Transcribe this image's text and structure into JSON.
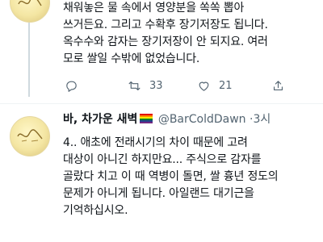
{
  "tweets": [
    {
      "lines": [
        "채워놓은 물 속에서 영양분을 쏙쏙 뽑아",
        "쓰거든요. 그리고 수확후 장기저장도 됩니다.",
        "옥수수와 감자는 장기저장이 안 되지요. 여러",
        "모로 쌀일 수밖에 없었습니다."
      ],
      "actions": {
        "reply": "",
        "retweet": "33",
        "like": "21"
      }
    },
    {
      "author_name": "바, 차가운 새벽",
      "author_handle": "@BarColdDawn",
      "separator": "·",
      "time": "3시",
      "lines": [
        "4.. 애초에 전래시기의 차이 때문에 고려",
        "대상이 아니긴 하지만요... 주식으로 감자를",
        "골랐다 치고 이 때 역병이 돌면, 쌀 흉년 정도의",
        "문제가 아니게 됩니다. 아일랜드 대기근을",
        "기억하십시오."
      ]
    }
  ],
  "icons": {
    "reply": "reply-icon",
    "retweet": "retweet-icon",
    "like": "heart-icon",
    "share": "share-icon"
  },
  "colors": {
    "text": "#0f1419",
    "muted": "#536471",
    "thread": "#cfd9de"
  }
}
